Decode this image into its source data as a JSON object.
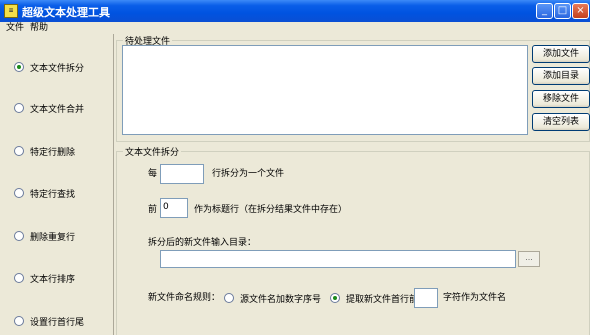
{
  "window": {
    "title": "超级文本处理工具",
    "app_icon": "doc-icon"
  },
  "menu": {
    "items": [
      "文件",
      "帮助"
    ]
  },
  "sidebar": {
    "items": [
      {
        "label": "文本文件拆分",
        "checked": true
      },
      {
        "label": "文本文件合并",
        "checked": false
      },
      {
        "label": "特定行删除",
        "checked": false
      },
      {
        "label": "特定行查找",
        "checked": false
      },
      {
        "label": "删除重复行",
        "checked": false
      },
      {
        "label": "文本行排序",
        "checked": false
      },
      {
        "label": "设置行首行尾",
        "checked": false
      }
    ]
  },
  "files_group": {
    "legend": "待处理文件",
    "buttons": {
      "add_file": "添加文件",
      "add_dir": "添加目录",
      "remove_file": "移除文件",
      "clear_list": "清空列表"
    }
  },
  "split_group": {
    "legend": "文本文件拆分",
    "per_prefix": "每",
    "per_value": "",
    "per_suffix": "行拆分为一个文件",
    "head_prefix": "前",
    "head_value": "0",
    "head_suffix": "作为标题行（在拆分结果文件中存在）",
    "output_dir_label": "拆分后的新文件输入目录：",
    "output_dir_value": "",
    "browse_label": "...",
    "naming_label": "新文件命名规则：",
    "naming_opt1": "源文件名加数字序号",
    "naming_opt2": "提取新文件首行前",
    "naming_chars_value": "",
    "naming_suffix": "字符作为文件名",
    "naming_selected": "opt2"
  }
}
